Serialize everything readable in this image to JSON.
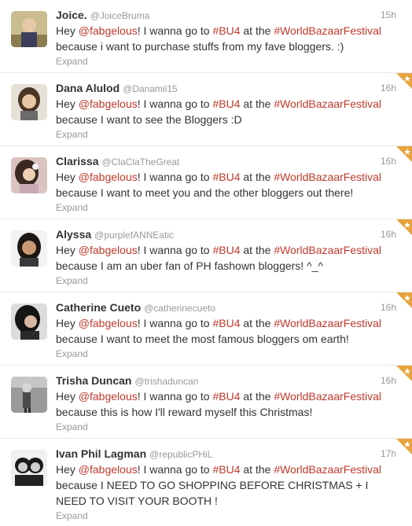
{
  "colors": {
    "link_red": "#c0392b",
    "muted_grey": "#999999",
    "text_dark": "#333333",
    "favorite_corner": "#e8a33d"
  },
  "tweets": [
    {
      "fullname": "Joice.",
      "username": "@JoiceBruma",
      "time": "15h",
      "text_hey": "Hey",
      "mention": "@fabgelous",
      "text_mid": "! I wanna go to",
      "hashtag1": "#BU4",
      "text_at": "at the",
      "hashtag2": "#WorldBazaarFestival",
      "text_because": "because i want to purchase stuffs from my fave bloggers. :)",
      "expand": "Expand",
      "favorited": false
    },
    {
      "fullname": "Dana Alulod",
      "username": "@Danamii15",
      "time": "16h",
      "text_hey": "Hey",
      "mention": "@fabgelous",
      "text_mid": "! I wanna go to",
      "hashtag1": "#BU4",
      "text_at": "at the",
      "hashtag2": "#WorldBazaarFestival",
      "text_because": "because I want to see the Bloggers :D",
      "expand": "Expand",
      "favorited": true
    },
    {
      "fullname": "Clarissa",
      "username": "@ClaClaTheGreat",
      "time": "16h",
      "text_hey": "Hey",
      "mention": "@fabgelous",
      "text_mid": "! I wanna go to",
      "hashtag1": "#BU4",
      "text_at": "at the",
      "hashtag2": "#WorldBazaarFestival",
      "text_because": "because I want to meet you and the other bloggers out there!",
      "expand": "Expand",
      "favorited": true
    },
    {
      "fullname": "Alyssa",
      "username": "@purplefANNEatic",
      "time": "16h",
      "text_hey": "Hey",
      "mention": "@fabgelous",
      "text_mid": "! I wanna go to",
      "hashtag1": "#BU4",
      "text_at": "at the",
      "hashtag2": "#WorldBazaarFestival",
      "text_because": "because I am an uber fan of PH fashown bloggers! ^_^",
      "expand": "Expand",
      "favorited": true
    },
    {
      "fullname": "Catherine Cueto",
      "username": "@catherinecueto",
      "time": "16h",
      "text_hey": "Hey",
      "mention": "@fabgelous",
      "text_mid": "! I wanna go to",
      "hashtag1": "#BU4",
      "text_at": "at the",
      "hashtag2": "#WorldBazaarFestival",
      "text_because": "because I want to meet the most famous bloggers om earth!",
      "expand": "Expand",
      "favorited": true
    },
    {
      "fullname": "Trisha Duncan",
      "username": "@trishaduncan",
      "time": "16h",
      "text_hey": "Hey",
      "mention": "@fabgelous",
      "text_mid": "! I wanna go to",
      "hashtag1": "#BU4",
      "text_at": "at the",
      "hashtag2": "#WorldBazaarFestival",
      "text_because": "because this is how I'll reward myself this Christmas!",
      "expand": "Expand",
      "favorited": true
    },
    {
      "fullname": "Ivan Phil Lagman",
      "username": "@republicPHiL",
      "time": "17h",
      "text_hey": "Hey",
      "mention": "@fabgelous",
      "text_mid": "! I wanna go to",
      "hashtag1": "#BU4",
      "text_at": "at the",
      "hashtag2": "#WorldBazaarFestival",
      "text_because": "because I NEED TO GO SHOPPING BEFORE CHRISTMAS + I NEED TO VISIT YOUR BOOTH !",
      "expand": "Expand",
      "favorited": true
    }
  ]
}
